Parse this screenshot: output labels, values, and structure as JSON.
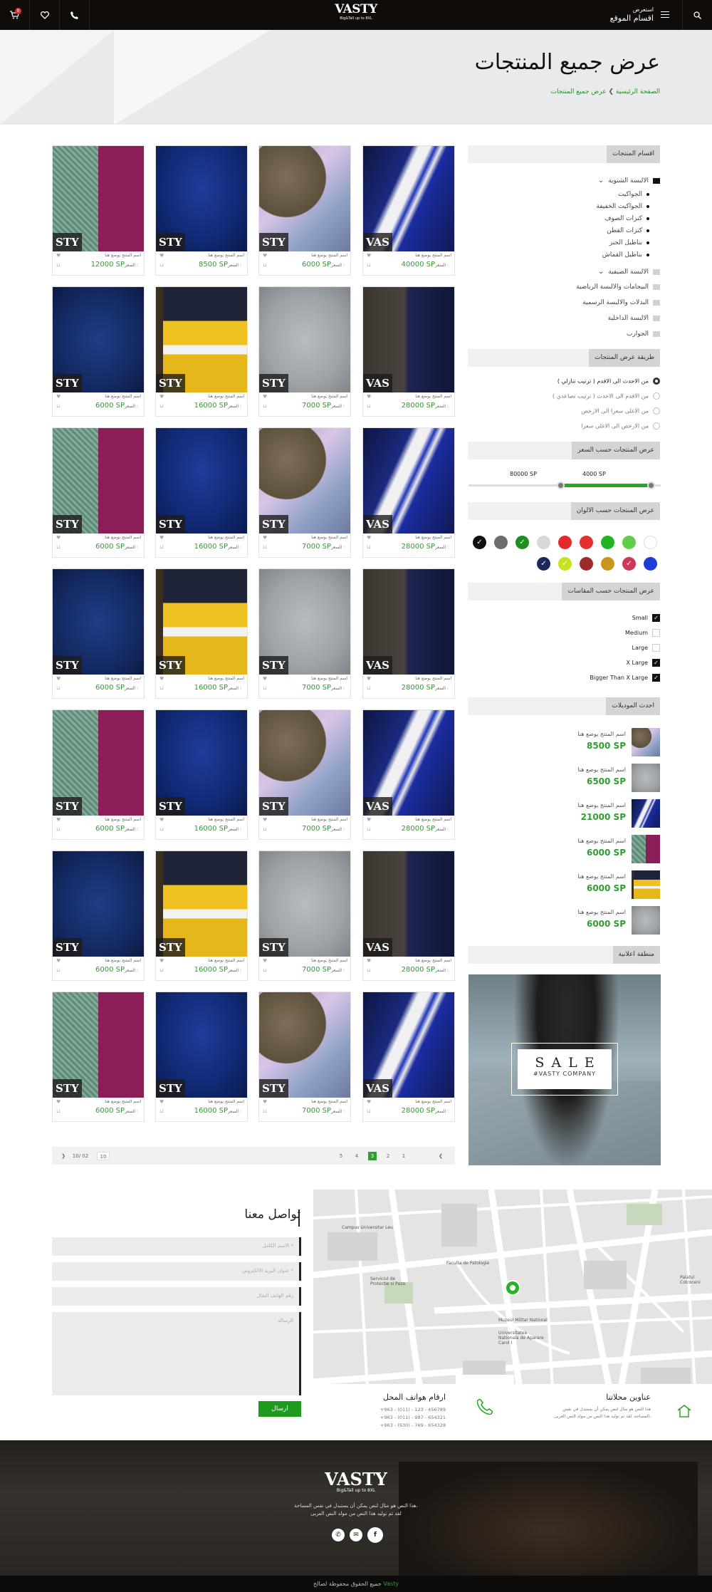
{
  "header": {
    "cart_count": "0",
    "logo_main": "VASTY",
    "logo_sub": "Big&Tall up to 8XL",
    "menu_small": "استعرض",
    "menu_big": "اقسام الموقع"
  },
  "hero": {
    "title": "عرض جميع المنتجات",
    "crumb_home": "الصفحة الرئيسية",
    "crumb_sep": "❯",
    "crumb_current": "عرض جميع المنتجات"
  },
  "sidebar": {
    "categories_title": "اقسام المنتجات",
    "categories": [
      {
        "label": "الالبسة الشتوية",
        "open": true,
        "children": [
          "الجواكيت",
          "الجواكيت الخفيفة",
          "كنزات الصوف",
          "كنزات القطن",
          "بناطيل الجنز",
          "بناطيل القماش"
        ]
      },
      {
        "label": "الالبسة الصيفية",
        "chevron": true
      },
      {
        "label": "البيجامات والالبسة الرياضية"
      },
      {
        "label": "البدلات والالبسة الرسمية"
      },
      {
        "label": "الالبسة الداخلية"
      },
      {
        "label": "الجوارب"
      }
    ],
    "sort_title": "طريقة عرض المنتجات",
    "sort_options": [
      "من الاحدث الى الاقدم ( ترتيب تنازلي )",
      "من الاقدم الى الاحدث ( ترتيب تصاعدي )",
      "من الاغلى سعرا الى الارخص",
      "من الارخص الى الاغلى سعرا"
    ],
    "sort_selected": 0,
    "price_title": "عرض المنتجات حسب السعر",
    "price_min": "4000 SP",
    "price_max": "80000 SP",
    "price_min_frac": 0.05,
    "price_max_frac": 0.52,
    "colors_title": "عرض المنتجات حسب الالوان",
    "colors": [
      {
        "hex": "#ffffff",
        "checked": false
      },
      {
        "hex": "#5fcf4a",
        "checked": false
      },
      {
        "hex": "#22b322",
        "checked": false
      },
      {
        "hex": "#e53030",
        "checked": false
      },
      {
        "hex": "#e32a2a",
        "checked": false
      },
      {
        "hex": "#d8d8d8",
        "checked": false
      },
      {
        "hex": "#1e8e1e",
        "checked": true
      },
      {
        "hex": "#6d6d6d",
        "checked": false
      },
      {
        "hex": "#111111",
        "checked": true
      },
      {
        "hex": "#1d3cd8",
        "checked": false
      },
      {
        "hex": "#c9395a",
        "checked": true
      },
      {
        "hex": "#c9961c",
        "checked": false
      },
      {
        "hex": "#9c2a2a",
        "checked": false
      },
      {
        "hex": "#c9e21e",
        "checked": true
      },
      {
        "hex": "#1b2a5a",
        "checked": true
      }
    ],
    "sizes_title": "عرض المنتجات حسب المقاسات",
    "sizes": [
      {
        "label": "Small",
        "checked": true
      },
      {
        "label": "Medium",
        "checked": false
      },
      {
        "label": "Large",
        "checked": false
      },
      {
        "label": "X Large",
        "checked": true
      },
      {
        "label": "Bigger Than X Large",
        "checked": true
      }
    ],
    "latest_title": "احدث الموديلات",
    "latest": [
      {
        "name": "اسم المنتج يوضع هنا",
        "price": "8500 SP",
        "img": "shirt"
      },
      {
        "name": "اسم المنتج يوضع هنا",
        "price": "6500 SP",
        "img": "knit"
      },
      {
        "name": "اسم المنتج يوضع هنا",
        "price": "21000 SP",
        "img": "suit"
      },
      {
        "name": "اسم المنتج يوضع هنا",
        "price": "6000 SP",
        "img": "plaid"
      },
      {
        "name": "اسم المنتج يوضع هنا",
        "price": "6000 SP",
        "img": "yellow"
      },
      {
        "name": "اسم المنتج يوضع هنا",
        "price": "6000 SP",
        "img": "knit"
      }
    ],
    "ad_title": "منطقة اعلانية",
    "ad_sale": "SALE",
    "ad_company": "#VASTY COMPANY"
  },
  "products": {
    "price_label": "السعر :",
    "caption": "اسم المنتج يوضع هنا",
    "rows": [
      [
        {
          "img": "suit",
          "price": "40000 SP"
        },
        {
          "img": "shirt",
          "price": "6000 SP"
        },
        {
          "img": "jeans",
          "price": "8500 SP"
        },
        {
          "img": "plaid",
          "price": "12000 SP"
        }
      ],
      [
        {
          "img": "suit2",
          "price": "28000 SP"
        },
        {
          "img": "knit",
          "price": "7000 SP"
        },
        {
          "img": "yellow",
          "price": "16000 SP"
        },
        {
          "img": "polo",
          "price": "6000 SP"
        }
      ],
      [
        {
          "img": "suit",
          "price": "28000 SP"
        },
        {
          "img": "shirt",
          "price": "7000 SP"
        },
        {
          "img": "jeans",
          "price": "16000 SP"
        },
        {
          "img": "plaid",
          "price": "6000 SP"
        }
      ],
      [
        {
          "img": "suit2",
          "price": "28000 SP"
        },
        {
          "img": "knit",
          "price": "7000 SP"
        },
        {
          "img": "yellow",
          "price": "16000 SP"
        },
        {
          "img": "polo",
          "price": "6000 SP"
        }
      ],
      [
        {
          "img": "suit",
          "price": "28000 SP"
        },
        {
          "img": "shirt",
          "price": "7000 SP"
        },
        {
          "img": "jeans",
          "price": "16000 SP"
        },
        {
          "img": "plaid",
          "price": "6000 SP"
        }
      ],
      [
        {
          "img": "suit2",
          "price": "28000 SP"
        },
        {
          "img": "knit",
          "price": "7000 SP"
        },
        {
          "img": "yellow",
          "price": "16000 SP"
        },
        {
          "img": "polo",
          "price": "6000 SP"
        }
      ],
      [
        {
          "img": "suit",
          "price": "28000 SP"
        },
        {
          "img": "shirt",
          "price": "7000 SP"
        },
        {
          "img": "jeans",
          "price": "16000 SP"
        },
        {
          "img": "plaid",
          "price": "6000 SP"
        }
      ]
    ]
  },
  "pager": {
    "next": "❯",
    "prev": "❮",
    "pages": [
      "5",
      "4",
      "3",
      "2",
      "1"
    ],
    "current": "3",
    "page_info": "10/ 02",
    "page_select": "10"
  },
  "contact": {
    "title": "تواصل معنا",
    "name_ph": "الاسم الكامل *",
    "email_ph": "عنوان البريد الالكتروني *",
    "phone_ph": "رقم الهاتف النقال",
    "msg_ph": "الرسالة",
    "send": "ارسال"
  },
  "addresses": {
    "title": "عناوين محلاتنا",
    "text1": "هذا النص هو مثال لنص يمكن أن يستبدل في نفس",
    "text2": "المساحة، لقد تم توليد هذا النص من مولد النص العربى،"
  },
  "phones": {
    "title": "ارقام هواتف المحل",
    "p1": "+963 - (011) - 123 - 456789",
    "p2": "+963 - (011) - 987 - 654321",
    "p3": "+963 - (930) - 769 - 654328"
  },
  "map_labels": [
    "Palatul Cotroceni",
    "Faculta de Patologie",
    "Universitatea Nationala de Aparare Carol I",
    "Muzeul Militar National",
    "Campus Universitar Leu",
    "Serviciul de Protectie si Paza"
  ],
  "footer": {
    "logo": "VASTY",
    "logo_sub": "Big&Tall up to 8XL",
    "text1": "هذا النص هو مثال لنص يمكن أن يستبدل في نفس المساحة،",
    "text2": "لقد تم توليد هذا النص من مولد النص العربى",
    "copy_before": "جميع الحقوق محفوظة لصالح",
    "copy_brand": "Vasty"
  }
}
